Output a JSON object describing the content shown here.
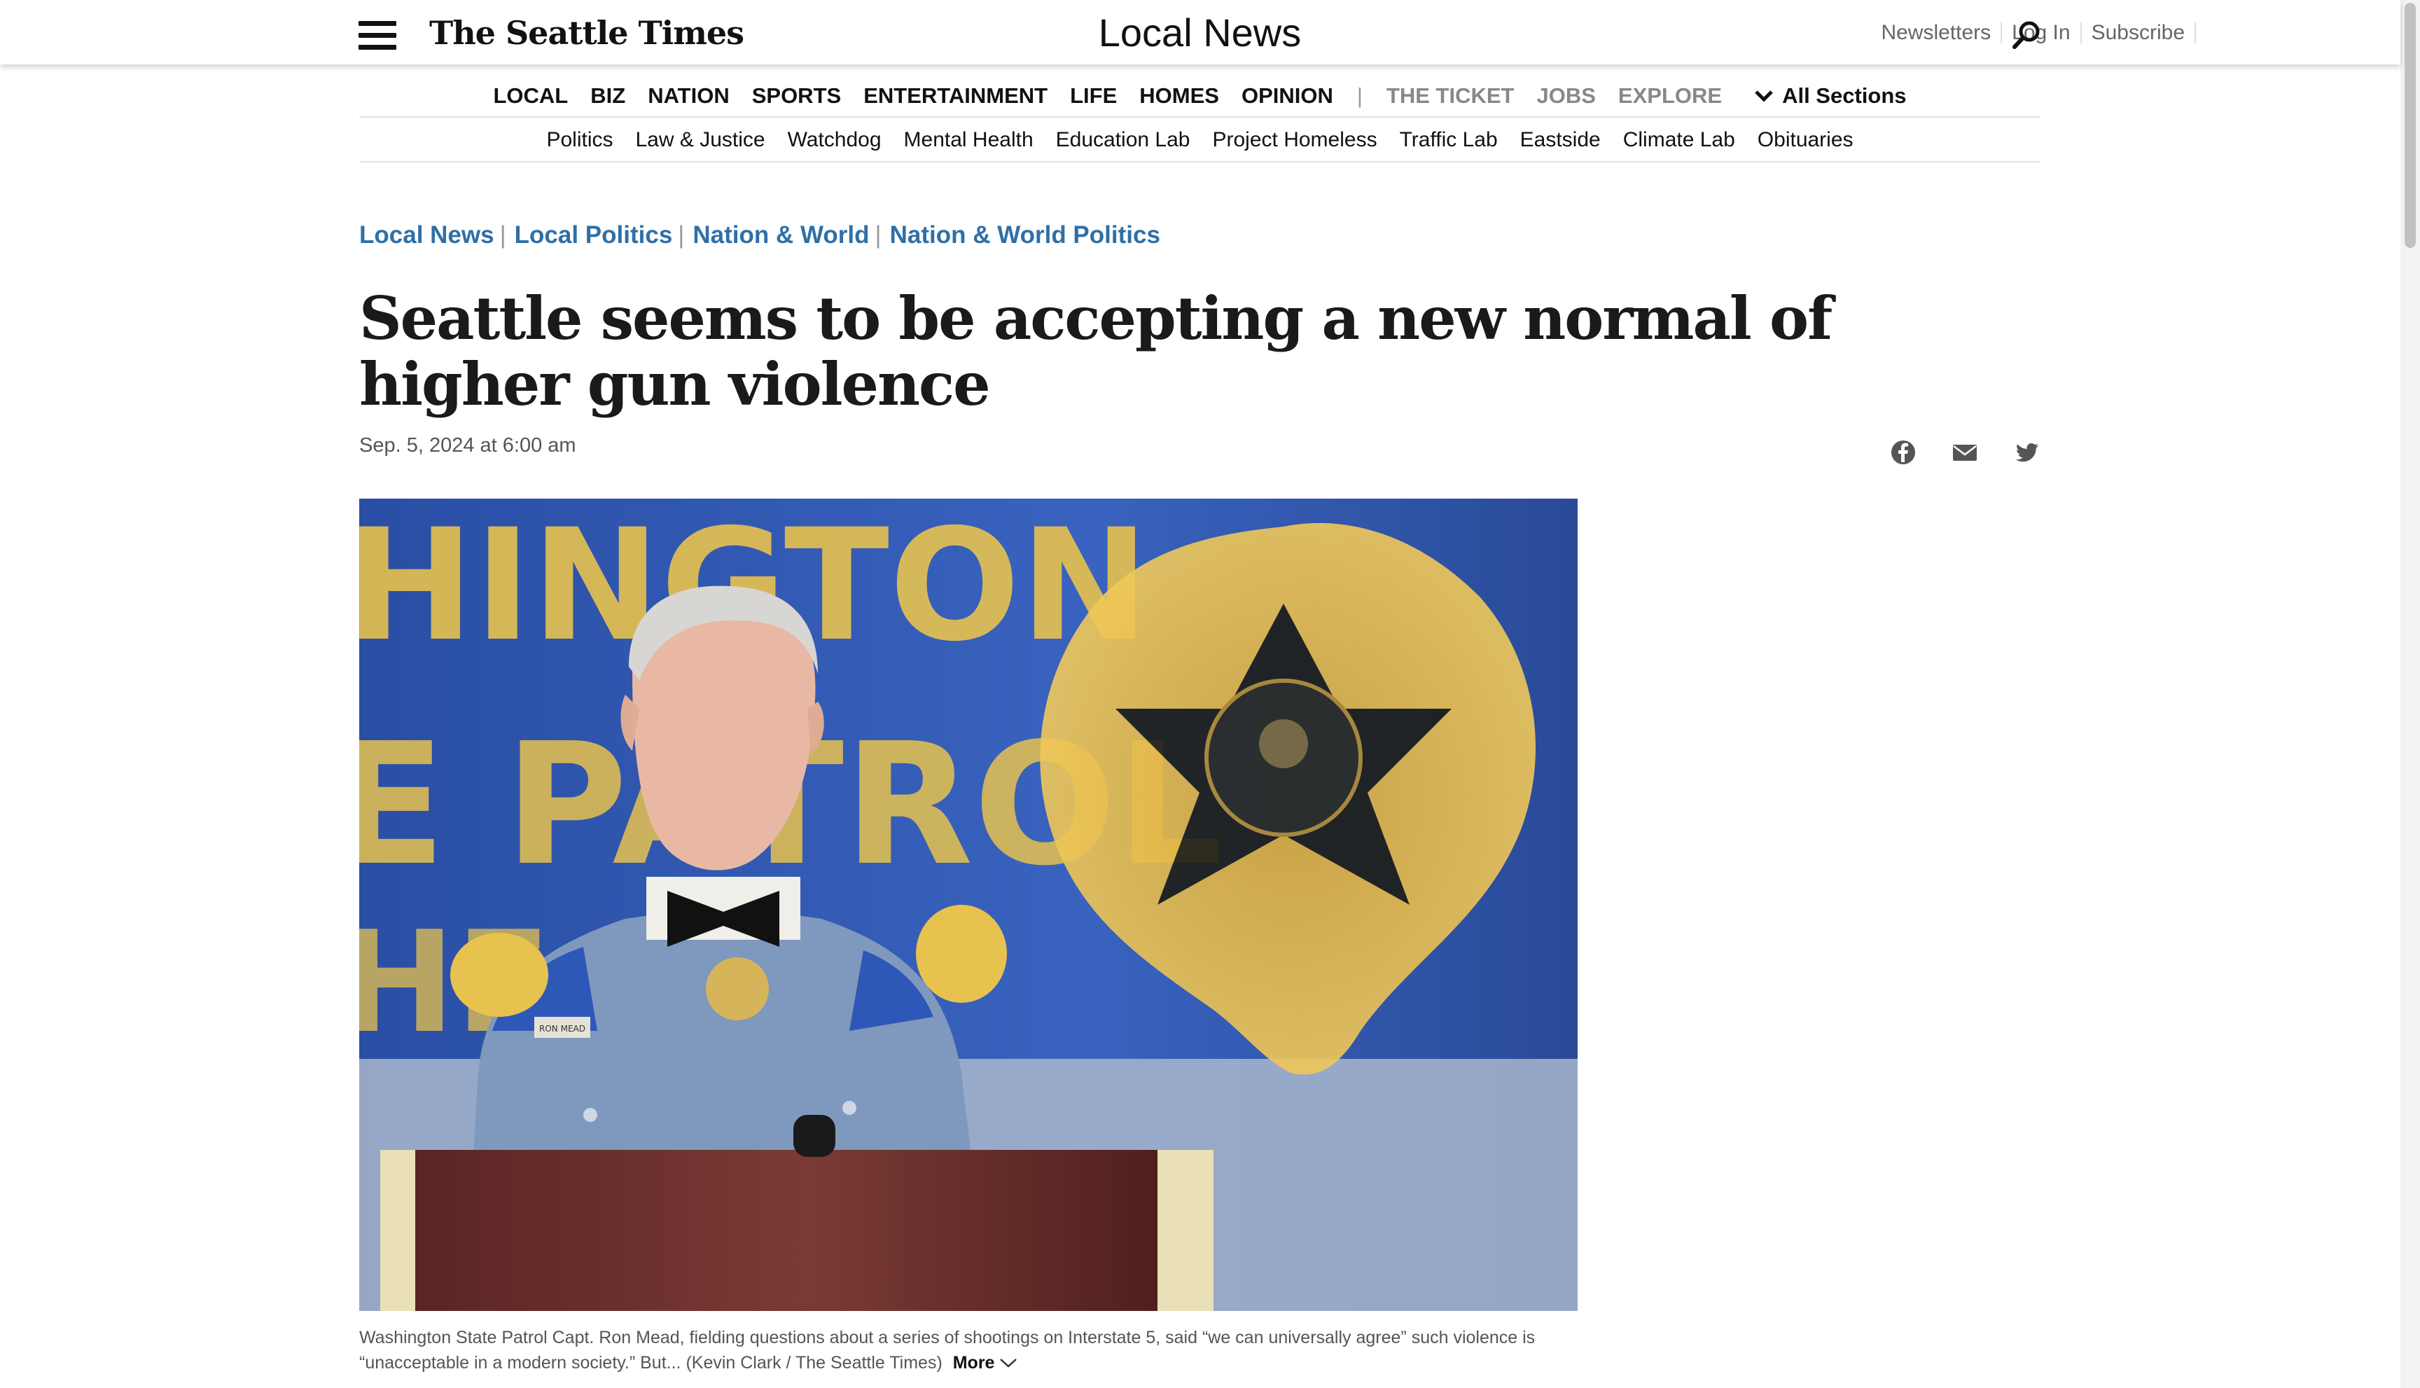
{
  "header": {
    "logo": "The Seattle Times",
    "section_title": "Local News",
    "util_links": [
      "Newsletters",
      "Log In",
      "Subscribe"
    ]
  },
  "nav_main": {
    "items": [
      "LOCAL",
      "BIZ",
      "NATION",
      "SPORTS",
      "ENTERTAINMENT",
      "LIFE",
      "HOMES",
      "OPINION"
    ],
    "divider": "|",
    "secondary": [
      "THE TICKET",
      "JOBS",
      "EXPLORE"
    ],
    "all_sections": "All Sections"
  },
  "nav_sub": {
    "items": [
      "Politics",
      "Law & Justice",
      "Watchdog",
      "Mental Health",
      "Education Lab",
      "Project Homeless",
      "Traffic Lab",
      "Eastside",
      "Climate Lab",
      "Obituaries"
    ]
  },
  "breadcrumbs": [
    "Local News",
    "Local Politics",
    "Nation & World",
    "Nation & World Politics"
  ],
  "article": {
    "headline": "Seattle seems to be accepting a new normal of higher gun violence",
    "dateline": "Sep. 5, 2024 at 6:00 am",
    "caption": "Washington State Patrol Capt. Ron Mead, fielding questions about a series of shootings on Interstate 5, said “we can universally agree” such violence is “unacceptable in a modern society.” But... (Kevin Clark / The Seattle Times)",
    "more_label": "More"
  },
  "photo": {
    "backdrop_text_top": "HINGTON",
    "backdrop_text_mid": "E PATROL",
    "backdrop_text_low": "HE",
    "nameplate": "RON MEAD"
  },
  "share_icons": [
    "facebook-icon",
    "email-icon",
    "twitter-icon"
  ],
  "colors": {
    "link_blue": "#2f6fa8",
    "backdrop_blue": "#2f56a8",
    "badge_gold": "#e7b93f",
    "uniform_blue": "#7f98bd"
  }
}
